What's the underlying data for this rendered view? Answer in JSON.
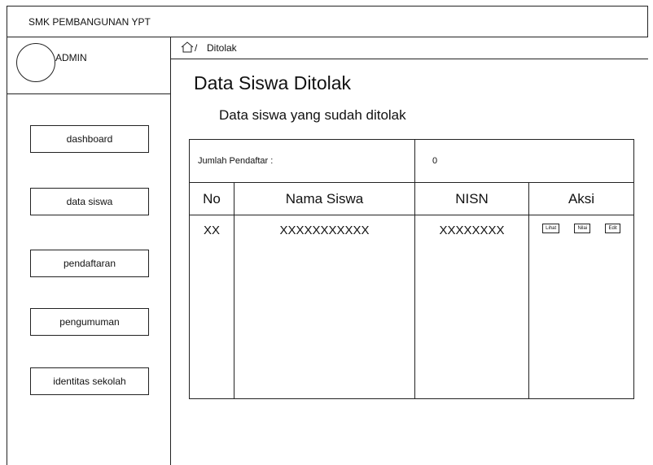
{
  "header": {
    "school_name": "SMK PEMBANGUNAN YPT"
  },
  "sidebar": {
    "user": "ADMIN",
    "items": [
      {
        "label": "dashboard"
      },
      {
        "label": "data siswa"
      },
      {
        "label": "pendaftaran"
      },
      {
        "label": "pengumuman"
      },
      {
        "label": "identitas sekolah"
      }
    ]
  },
  "breadcrumb": {
    "separator": "/",
    "current": "Ditolak",
    "icon": "home-icon"
  },
  "main": {
    "title": "Data Siswa Ditolak",
    "subtitle": "Data siswa yang sudah ditolak",
    "summary": {
      "label": "Jumlah Pendaftar :",
      "value": "0"
    },
    "table": {
      "columns": [
        "No",
        "Nama Siswa",
        "NISN",
        "Aksi"
      ],
      "rows": [
        {
          "no": "XX",
          "nama": "XXXXXXXXXXX",
          "nisn": "XXXXXXXX",
          "actions": [
            "Lihat",
            "Nilai",
            "Edit"
          ]
        }
      ]
    }
  }
}
